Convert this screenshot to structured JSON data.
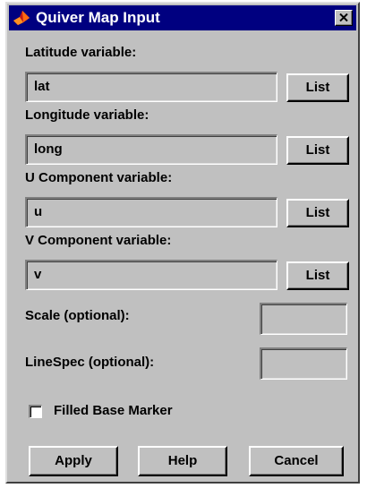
{
  "window": {
    "title": "Quiver Map Input",
    "logo_icon": "matlab-membrane-logo",
    "close_icon": "close-x"
  },
  "fields": {
    "latitude": {
      "label": "Latitude variable:",
      "value": "lat",
      "list_button": "List"
    },
    "longitude": {
      "label": "Longitude variable:",
      "value": "long",
      "list_button": "List"
    },
    "u_component": {
      "label": "U Component variable:",
      "value": "u",
      "list_button": "List"
    },
    "v_component": {
      "label": "V Component variable:",
      "value": "v",
      "list_button": "List"
    }
  },
  "scale": {
    "label": "Scale (optional):",
    "value": ""
  },
  "linespec": {
    "label": "LineSpec (optional):",
    "value": ""
  },
  "filled_base_marker": {
    "label": "Filled Base Marker",
    "checked": false
  },
  "buttons": {
    "apply": "Apply",
    "help": "Help",
    "cancel": "Cancel"
  },
  "colors": {
    "titlebar": "#000080",
    "face": "#c0c0c0"
  }
}
